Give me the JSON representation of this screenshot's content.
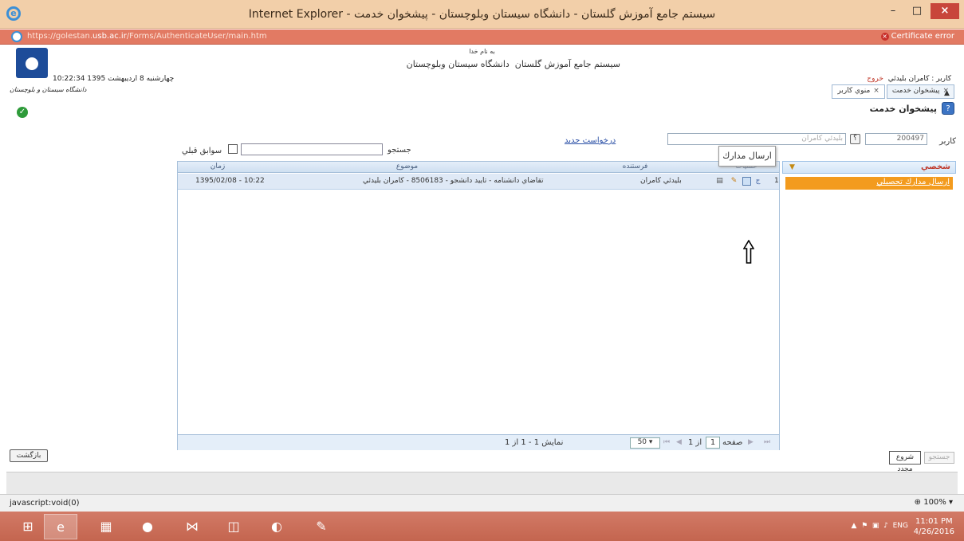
{
  "window": {
    "title": "Internet Explorer - سيستم جامع آموزش گلستان - دانشگاه سيستان وبلوچستان - پيشخوان خدمت",
    "minimize": "–",
    "maximize": "□",
    "close": "×"
  },
  "address": {
    "url_prefix": "https://golestan.",
    "url_domain": "usb.ac.ir",
    "url_suffix": "/Forms/AuthenticateUser/main.htm",
    "certificate": "Certificate error"
  },
  "header": {
    "besm": "به نام خدا",
    "system_name": "سيستم جامع آموزش گلستان",
    "university": "دانشگاه سيستان وبلوچستان",
    "datetime": "10:22:34 چهارشنبه 8 ارديبهشت 1395",
    "logo_caption": "دانشگاه سیستان و بلوچستان",
    "user_label": "کاربر : کامران بليدئي",
    "logout": "خروج"
  },
  "tabs": [
    {
      "label": "پيشخوان خدمت",
      "close": "×"
    },
    {
      "label": "منوي كاربر",
      "close": "×"
    }
  ],
  "page": {
    "heading": "پيشخوان خدمت",
    "help": "?",
    "user_field_label": "كاربر",
    "user_id": "200497",
    "user_name": "بليدئي كامران",
    "lookup": "؟",
    "new_request": "درخواست جديد",
    "search_label": "جستجو",
    "search_value": "",
    "previous_label": "سوابق قبلي"
  },
  "tooltip": "ارسال مدارك",
  "grid": {
    "columns": [
      "عمليات",
      "فرستنده",
      "موضوع",
      "زمان"
    ],
    "rows": [
      {
        "index": "1",
        "sender": "بليدئي كامران",
        "subject": "تقاضاي دانشنامه - تاييد دانشجو - 8506183 - كامران بليدئي",
        "time": "1395/02/08 - 10:22"
      }
    ],
    "footer": {
      "show_range": "نمايش 1 - 1 از 1",
      "page_label": "صفحه",
      "page_current": "1",
      "page_of": "از 1",
      "page_size": "50"
    }
  },
  "side": {
    "group": "شخصي",
    "item": "ارسال مدارك تحصيلي"
  },
  "buttons": {
    "back": "بازگشت",
    "start": "شروع مجدد",
    "search": "جستجو"
  },
  "status": {
    "text": "javascript:void(0)",
    "zoom": "100%"
  },
  "taskbar": {
    "lang": "ENG",
    "time": "11:01 PM",
    "date": "4/26/2016"
  },
  "colors": {
    "titlebar": "#f2cfa9",
    "addressbar": "#e27a63",
    "side_item": "#f39b1e",
    "grid_row": "#dfe9f6"
  }
}
